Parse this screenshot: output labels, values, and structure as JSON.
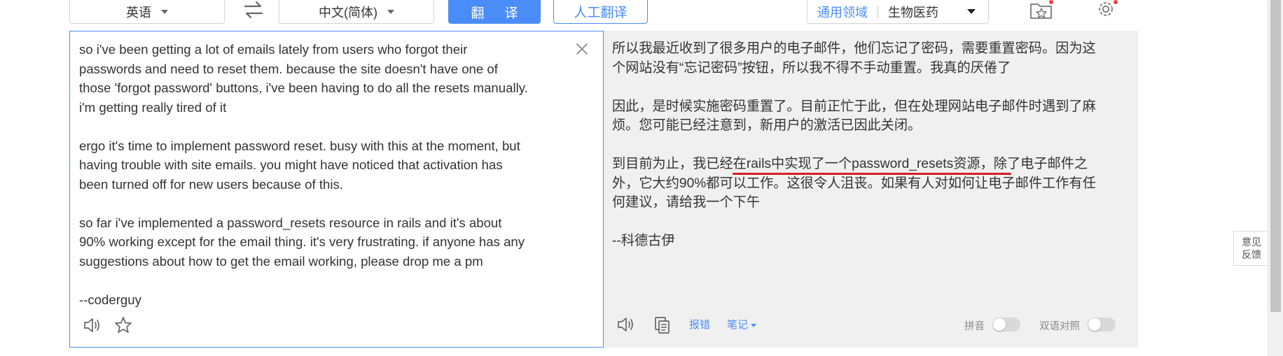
{
  "toolbar": {
    "source_lang": "英语",
    "target_lang": "中文(简体)",
    "translate_label": "翻 译",
    "human_translate_label": "人工翻译",
    "domain_general": "通用领域",
    "domain_specific": "生物医药",
    "icons": [
      "swap-icon",
      "favorites-folder-icon",
      "settings-gear-icon"
    ]
  },
  "source": {
    "text": "so i've been getting a lot of emails lately from users who forgot their\npasswords and need to reset them. because the site doesn't have one of\nthose 'forgot password' buttons, i've been having to do all the resets manually.\ni'm getting really tired of it\n\nergo it's time to implement password reset. busy with this at the moment, but\nhaving trouble with site emails. you might have noticed that activation has\nbeen turned off for new users because of this.\n\nso far i've implemented a password_resets resource in rails and it's about\n90% working except for the email thing. it's very frustrating. if anyone has any\nsuggestions about how to get the email working, please drop me a pm\n\n--coderguy",
    "icons": [
      "clear-icon",
      "speaker-icon",
      "star-icon"
    ]
  },
  "result": {
    "text": "所以我最近收到了很多用户的电子邮件，他们忘记了密码，需要重置密码。因为这\n个网站没有“忘记密码”按钮，所以我不得不手动重置。我真的厌倦了\n\n因此，是时候实施密码重置了。目前正忙于此，但在处理网站电子邮件时遇到了麻\n烦。您可能已经注意到，新用户的激活已因此关闭。\n\n到目前为止，我已经在rails中实现了一个password_resets资源，除了电子邮件之\n外，它大约90%都可以工作。这很令人沮丧。如果有人对如何让电子邮件工作有任\n何建议，请给我一个下午\n\n--科德古伊",
    "report_error_label": "报错",
    "notes_label": "笔记",
    "pinyin_label": "拼音",
    "bilingual_label": "双语对照",
    "pinyin_on": false,
    "bilingual_on": false,
    "icons": [
      "speaker-icon",
      "copy-icon"
    ]
  },
  "feedback": {
    "line1": "意见",
    "line2": "反馈"
  },
  "colors": {
    "accent": "#4a8df8",
    "result_bg": "#f0f0f0",
    "underline": "#d81e1e",
    "notification_dot": "#f0433a"
  }
}
